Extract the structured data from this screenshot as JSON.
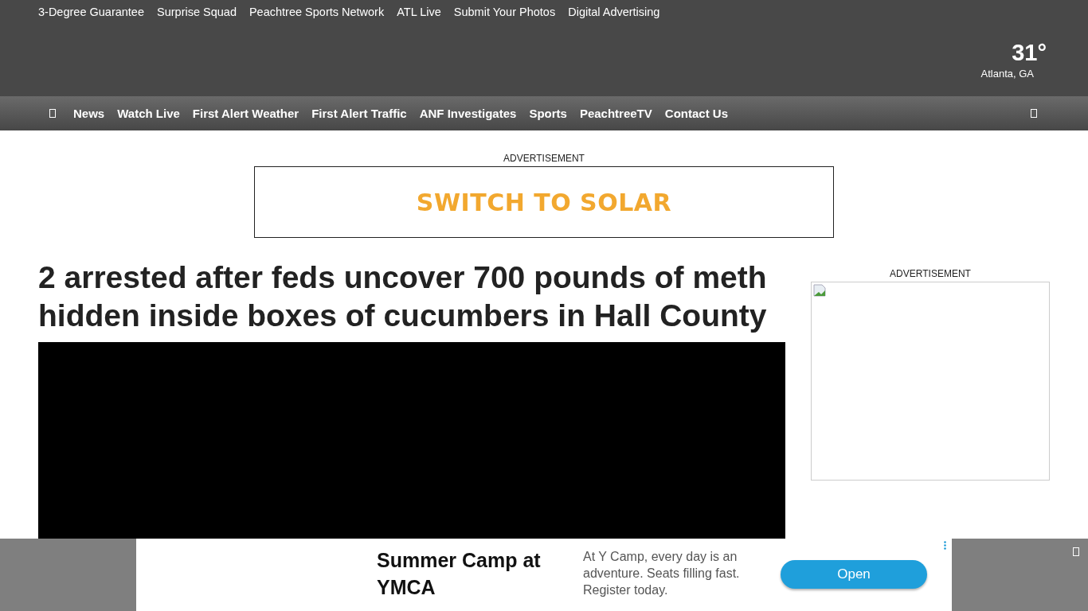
{
  "top_links": [
    "3-Degree Guarantee",
    "Surprise Squad",
    "Peachtree Sports Network",
    "ATL Live",
    "Submit Your Photos",
    "Digital Advertising"
  ],
  "weather": {
    "temperature": "31°",
    "location": "Atlanta, GA"
  },
  "nav": {
    "items": [
      "News",
      "Watch Live",
      "First Alert Weather",
      "First Alert Traffic",
      "ANF Investigates",
      "Sports",
      "PeachtreeTV",
      "Contact Us"
    ]
  },
  "banner_ad": {
    "label": "ADVERTISEMENT",
    "text": "SWITCH TO SOLAR"
  },
  "article": {
    "headline": "2 arrested after feds uncover 700 pounds of meth hidden inside boxes of cucumbers in Hall County"
  },
  "sidebar_ad": {
    "label": "ADVERTISEMENT"
  },
  "bottom_ad": {
    "title": "Summer Camp at YMCA",
    "body": "At Y Camp, every day is an adventure. Seats filling fast. Register today.",
    "button": "Open"
  }
}
